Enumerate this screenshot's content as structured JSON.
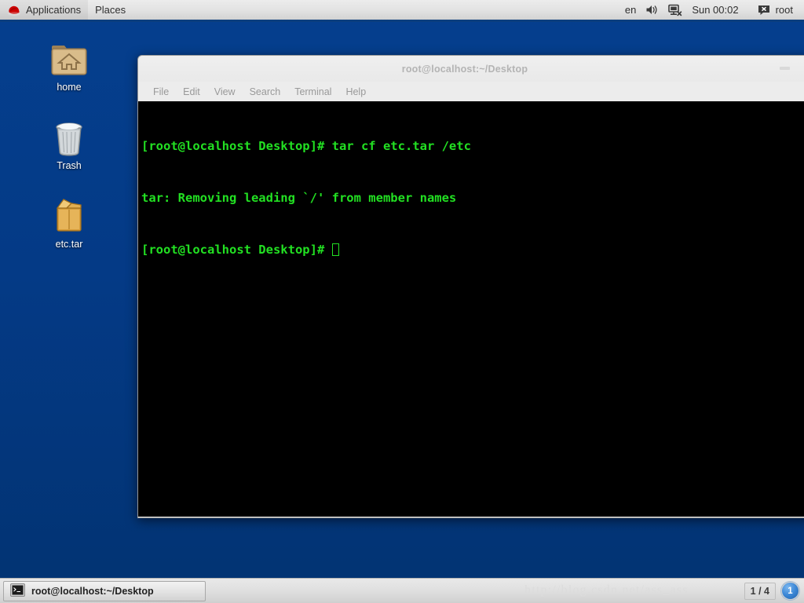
{
  "top_panel": {
    "applications_label": "Applications",
    "places_label": "Places",
    "redhat_icon": "redhat-logo-icon",
    "keyboard_layout": "en",
    "volume_icon": "volume-speaker-icon",
    "network_icon": "network-disconnected-icon",
    "clock": "Sun 00:02",
    "user_icon": "user-status-icon",
    "user_label": "root"
  },
  "desktop": {
    "icons": [
      {
        "name": "home",
        "label": "home",
        "icon": "home-folder-icon"
      },
      {
        "name": "trash",
        "label": "Trash",
        "icon": "trash-can-icon"
      },
      {
        "name": "etc-tar",
        "label": "etc.tar",
        "icon": "archive-package-icon"
      }
    ]
  },
  "terminal": {
    "title": "root@localhost:~/Desktop",
    "minimize_icon": "minimize-icon",
    "menu": [
      "File",
      "Edit",
      "View",
      "Search",
      "Terminal",
      "Help"
    ],
    "lines": [
      "[root@localhost Desktop]# tar cf etc.tar /etc",
      "tar: Removing leading `/' from member names",
      "[root@localhost Desktop]# "
    ],
    "colors": {
      "background": "#000000",
      "foreground": "#22e022"
    }
  },
  "bottom_panel": {
    "task_icon": "terminal-window-icon",
    "task_label": "root@localhost:~/Desktop",
    "watermark": "http://blog.csdn.net/ass_ass",
    "workspace_indicator": "1 / 4",
    "notification_count": "1"
  }
}
